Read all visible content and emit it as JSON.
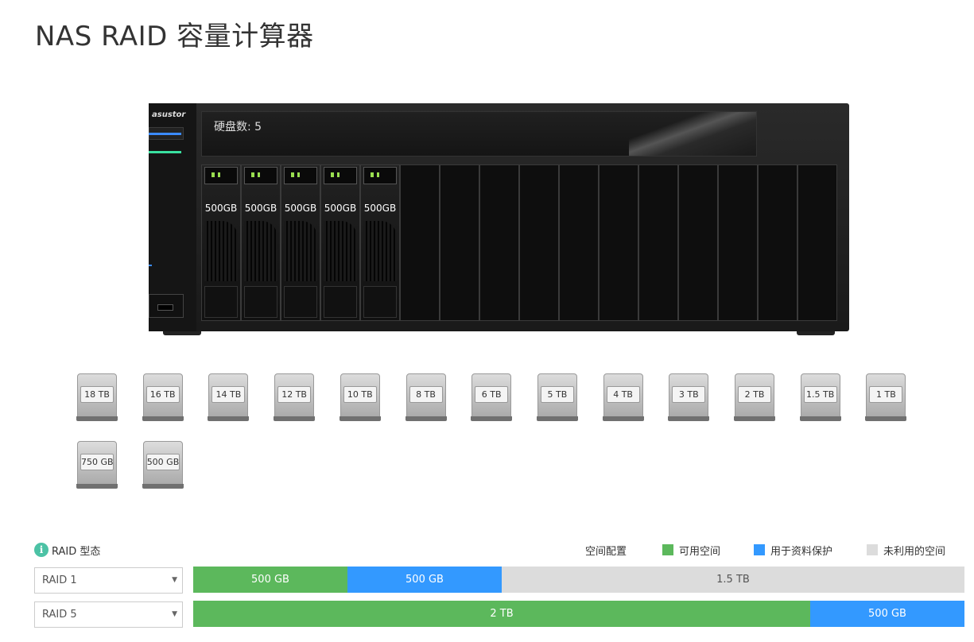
{
  "page": {
    "title": "NAS RAID 容量计算器"
  },
  "nas": {
    "brand": "asustor",
    "disk_count_label": "硬盘数: 5",
    "bay_total": 16,
    "installed_disks": [
      "500GB",
      "500GB",
      "500GB",
      "500GB",
      "500GB"
    ]
  },
  "disk_options": [
    "18 TB",
    "16 TB",
    "14 TB",
    "12 TB",
    "10 TB",
    "8 TB",
    "6 TB",
    "5 TB",
    "4 TB",
    "3 TB",
    "2 TB",
    "1.5 TB",
    "1 TB",
    "750 GB",
    "500 GB"
  ],
  "raid": {
    "heading": "RAID 型态",
    "info_icon": "info-icon",
    "rows": [
      {
        "type": "RAID 1",
        "segments": [
          {
            "kind": "usable",
            "label": "500 GB",
            "fraction": 0.2
          },
          {
            "kind": "protect",
            "label": "500 GB",
            "fraction": 0.2
          },
          {
            "kind": "unused",
            "label": "1.5 TB",
            "fraction": 0.6
          }
        ]
      },
      {
        "type": "RAID 5",
        "segments": [
          {
            "kind": "usable",
            "label": "2 TB",
            "fraction": 0.8
          },
          {
            "kind": "protect",
            "label": "500 GB",
            "fraction": 0.2
          }
        ]
      }
    ]
  },
  "legend": {
    "title": "空间配置",
    "items": [
      {
        "label": "可用空间",
        "color": "#5cb85c"
      },
      {
        "label": "用于资料保护",
        "color": "#3399ff"
      },
      {
        "label": "未利用的空间",
        "color": "#dcdcdc"
      }
    ]
  }
}
